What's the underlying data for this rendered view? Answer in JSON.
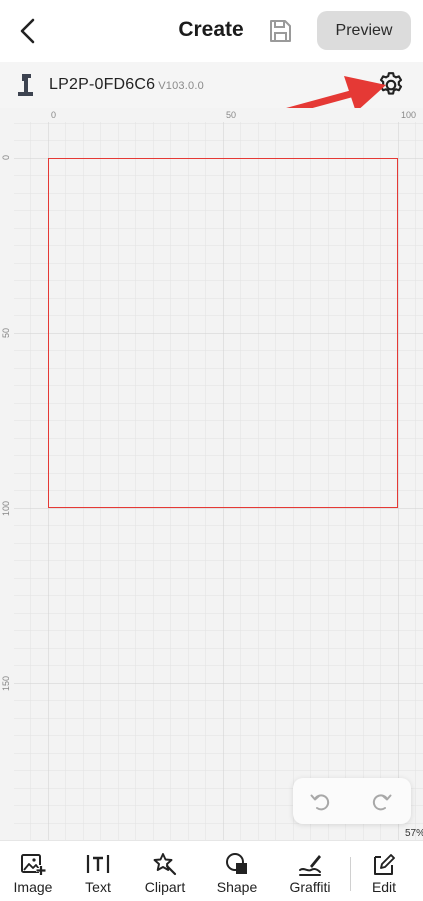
{
  "header": {
    "title": "Create",
    "preview_label": "Preview"
  },
  "device": {
    "name": "LP2P-0FD6C6",
    "version": "V103.0.0"
  },
  "ruler": {
    "top": [
      "0",
      "50",
      "100"
    ],
    "left": [
      "0",
      "50",
      "100",
      "150"
    ]
  },
  "canvas": {
    "zoom": "57%",
    "work_area_color": "#e53935"
  },
  "toolbar": {
    "items": [
      {
        "label": "Image",
        "icon": "image-add-icon"
      },
      {
        "label": "Text",
        "icon": "text-icon"
      },
      {
        "label": "Clipart",
        "icon": "clipart-icon"
      },
      {
        "label": "Shape",
        "icon": "shape-icon"
      },
      {
        "label": "Graffiti",
        "icon": "graffiti-icon"
      },
      {
        "label": "Edit",
        "icon": "edit-icon"
      }
    ]
  },
  "colors": {
    "accent_arrow": "#e53935",
    "canvas_bg": "#f3f3f3"
  }
}
